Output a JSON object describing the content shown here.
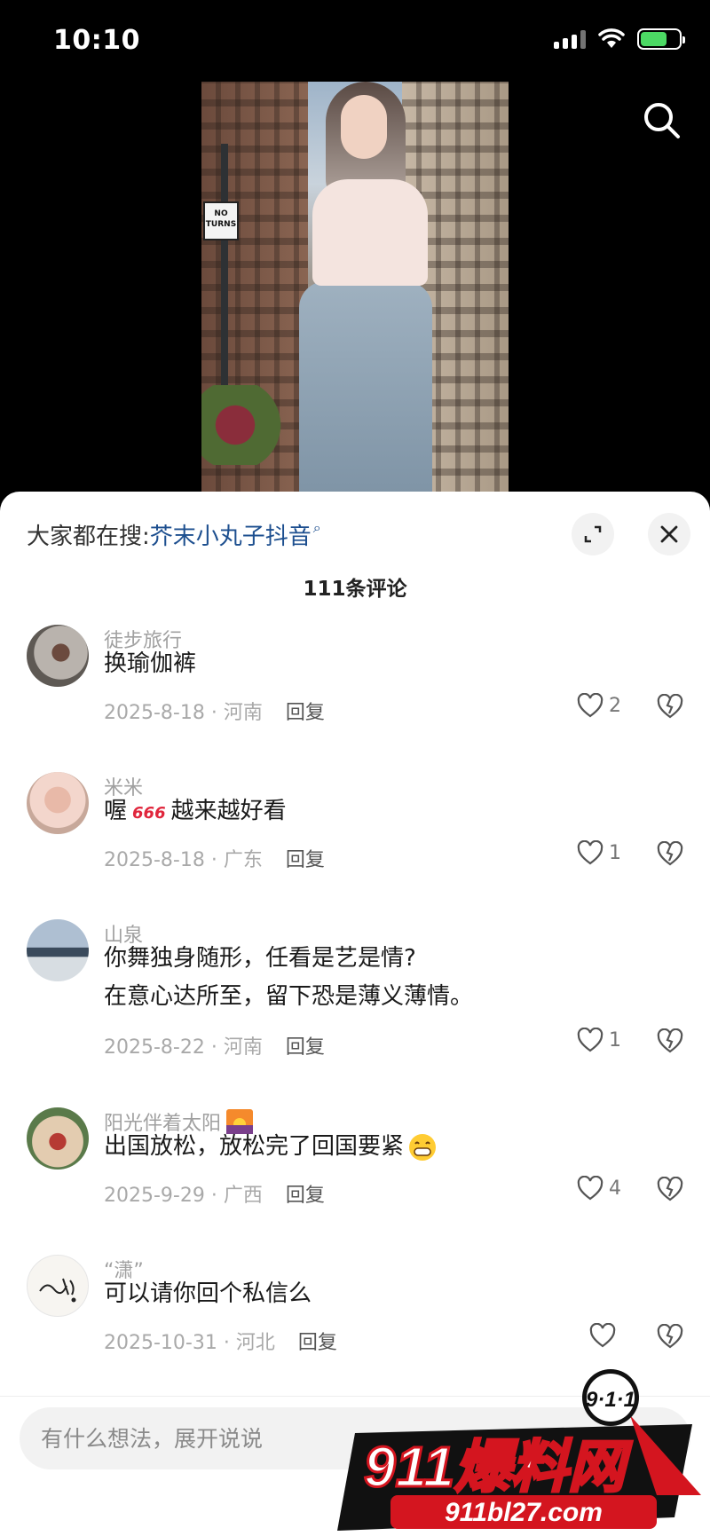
{
  "status_bar": {
    "time": "10:10"
  },
  "video": {
    "sign_text": "NO TURNS"
  },
  "sheet": {
    "hot_search_prefix": "大家都在搜: ",
    "hot_search_link": "芥末小丸子抖音",
    "comment_count": "111条评论"
  },
  "comments": [
    {
      "user": "徒步旅行",
      "text": "换瑜伽裤",
      "meta": "2025-8-18 · 河南",
      "reply": "回复",
      "likes": "2"
    },
    {
      "user": "米米",
      "text_before": "喔",
      "emoji": "666",
      "text_after": "越来越好看",
      "meta": "2025-8-18 · 广东",
      "reply": "回复",
      "likes": "1"
    },
    {
      "user": "山泉",
      "text_line1": "你舞独身随形，任看是艺是情?",
      "text_line2": "在意心达所至，留下恐是薄义薄情。",
      "meta": "2025-8-22 · 河南",
      "reply": "回复",
      "likes": "1"
    },
    {
      "user": "阳光伴着太阳",
      "text": "出国放松，放松完了回国要紧",
      "meta": "2025-9-29 · 广西",
      "reply": "回复",
      "likes": "4"
    },
    {
      "user": "“潇”",
      "text": "可以请你回个私信么",
      "meta": "2025-10-31 · 河北",
      "reply": "回复",
      "likes": ""
    }
  ],
  "input": {
    "placeholder": "有什么想法，展开说说"
  },
  "watermark": {
    "top": "9·1·1",
    "main": "911爆料网",
    "url": "911bl27.com"
  }
}
